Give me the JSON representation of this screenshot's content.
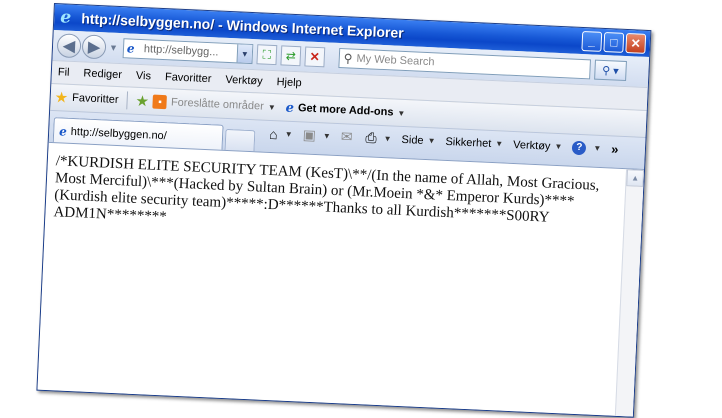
{
  "window": {
    "title": "http://selbyggen.no/ - Windows Internet Explorer"
  },
  "address": {
    "value": "http://selbygg..."
  },
  "search": {
    "placeholder": "My Web Search"
  },
  "menu": [
    "Fil",
    "Rediger",
    "Vis",
    "Favoritter",
    "Verktøy",
    "Hjelp"
  ],
  "favorites_bar": {
    "favorites_label": "Favoritter",
    "suggested_sites": "Foreslåtte områder",
    "get_addons": "Get more Add-ons"
  },
  "tab": {
    "label": "http://selbyggen.no/"
  },
  "command_bar": {
    "page": "Side",
    "safety": "Sikkerhet",
    "tools": "Verktøy",
    "more": "»"
  },
  "page": {
    "text": "/*KURDISH ELITE SECURITY TEAM (KesT)\\**/(In the name of Allah, Most Gracious, Most Merciful)\\***(Hacked by Sultan Brain) or (Mr.Moein *&* Emperor Kurds)****(Kurdish elite security team)*****:D******Thanks to all Kurdish*******S00RY ADM1N********"
  },
  "icons": {
    "back": "back-arrow-icon",
    "forward": "forward-arrow-icon",
    "refresh": "refresh-icon",
    "stop": "stop-icon",
    "search": "search-magnifier-icon",
    "home": "home-icon",
    "feeds": "rss-feed-icon",
    "mail": "mail-icon",
    "print": "printer-icon",
    "help": "help-icon"
  }
}
